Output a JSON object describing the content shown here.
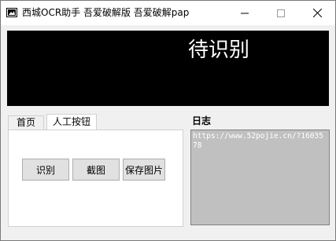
{
  "window": {
    "title": "西城OCR助手 吾爱破解版 吾爱破解pap",
    "controls": {
      "minimize": "minimize",
      "maximize": "maximize",
      "close": "close"
    }
  },
  "display": {
    "status_text": "待识别"
  },
  "tabs": [
    {
      "label": "首页",
      "active": false
    },
    {
      "label": "人工按钮",
      "active": true
    }
  ],
  "actions": {
    "recognize_label": "识别",
    "screenshot_label": "截图",
    "save_label": "保存图片"
  },
  "log": {
    "label": "日志",
    "content": "https://www.52pojie.cn/?1603578"
  },
  "colors": {
    "display_bg": "#000000",
    "display_text": "#ffffff",
    "log_bg": "#c0c0c0",
    "button_bg": "#e1e1e1"
  }
}
